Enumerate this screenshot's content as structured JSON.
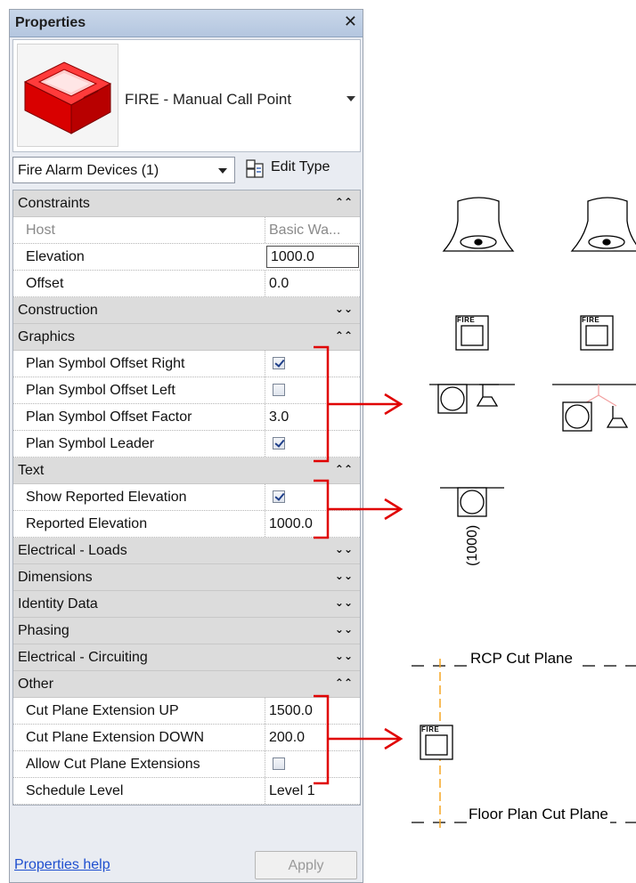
{
  "panel": {
    "title": "Properties",
    "close_glyph": "✕",
    "type_name": "FIRE - Manual Call Point",
    "filter_value": "Fire Alarm Devices (1)",
    "edit_type_label": "Edit Type",
    "help_link": "Properties help",
    "apply_label": "Apply"
  },
  "groups": {
    "constraints": "Constraints",
    "construction": "Construction",
    "graphics": "Graphics",
    "text": "Text",
    "electrical_loads": "Electrical - Loads",
    "dimensions": "Dimensions",
    "identity_data": "Identity Data",
    "phasing": "Phasing",
    "electrical_circuiting": "Electrical - Circuiting",
    "other": "Other"
  },
  "props": {
    "host": {
      "label": "Host",
      "value": "Basic Wa..."
    },
    "elevation": {
      "label": "Elevation",
      "value": "1000.0"
    },
    "offset": {
      "label": "Offset",
      "value": "0.0"
    },
    "plan_offset_right": {
      "label": "Plan Symbol Offset Right",
      "checked": true
    },
    "plan_offset_left": {
      "label": "Plan Symbol Offset Left",
      "checked": false
    },
    "plan_offset_factor": {
      "label": "Plan Symbol Offset Factor",
      "value": "3.0"
    },
    "plan_leader": {
      "label": "Plan Symbol Leader",
      "checked": true
    },
    "show_reported_elev": {
      "label": "Show Reported Elevation",
      "checked": true
    },
    "reported_elev": {
      "label": "Reported Elevation",
      "value": "1000.0"
    },
    "cut_up": {
      "label": "Cut Plane Extension UP",
      "value": "1500.0"
    },
    "cut_down": {
      "label": "Cut Plane Extension DOWN",
      "value": "200.0"
    },
    "allow_cut": {
      "label": "Allow Cut Plane Extensions",
      "checked": false
    },
    "schedule_level": {
      "label": "Schedule Level",
      "value": "Level 1"
    }
  },
  "chevrons": {
    "collapse": "⌃⌃",
    "expand": "⌄⌄"
  },
  "diagram": {
    "fire_text": "FIRE",
    "elev_tag": "(1000)",
    "rcp_label": "RCP Cut Plane",
    "floor_label": "Floor Plan Cut Plane"
  },
  "colors": {
    "annotation_red": "#e00000",
    "cut_line_orange": "#f5a623",
    "leader_pink": "#f2a0a0"
  }
}
